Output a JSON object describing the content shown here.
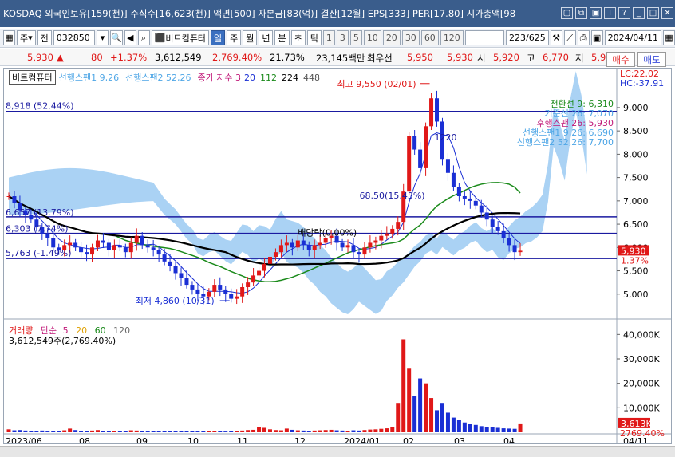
{
  "window": {
    "title": "KOSDAQ 외국인보유[159(천)] 주식수[16,623(천)] 액면[500] 자본금[83(억)] 결산[12월] EPS[333] PER[17.80] 시가총액[98",
    "buttons": [
      "▢",
      "⧉",
      "▣",
      "T",
      "?",
      "_",
      "□",
      "✕"
    ]
  },
  "toolbar": {
    "market_select": "주",
    "prev_label": "전",
    "code_input": "032850",
    "stock_name": "비트컴퓨터",
    "period_tabs": [
      "일",
      "주",
      "월",
      "년",
      "분",
      "초",
      "틱"
    ],
    "active_period": "일",
    "intervals": [
      "1",
      "3",
      "5",
      "10",
      "20",
      "30",
      "60",
      "120"
    ],
    "page_count": "223/625",
    "date_input": "2024/04/11"
  },
  "quote": {
    "price": "5,930",
    "change": "80",
    "change_pct": "+1.37%",
    "volume": "3,612,549",
    "volume_ratio": "2,769.40%",
    "turnover": "21.73%",
    "trade_value": "23,145백만",
    "best_ask_label": "최우선",
    "best_ask": "5,950",
    "best_bid": "5,930",
    "open_label": "시",
    "open": "5,920",
    "high_label": "고",
    "high": "6,770",
    "low_label": "저",
    "low": "5,920",
    "buy_label": "매수",
    "sell_label": "매도"
  },
  "chart_legend": {
    "name": "비트컴퓨터",
    "span1": "선행스팬1 9,26",
    "span2": "선행스팬2 52,26",
    "ma_label": "종가 지수 3",
    "ma_periods": [
      "20",
      "112",
      "224",
      "448"
    ],
    "lc": "LC:22.02",
    "hc": "HC:-37.91"
  },
  "annotations": {
    "high": "최고 9,550 (02/01)",
    "low": "최저 4,860 (10/31)",
    "line_8918": "8,918 (52.44%)",
    "line_6657": "6,657 (13.79%)",
    "line_6303": "6,303 (7.74%)",
    "line_5763": "5,763 (-1.49%)",
    "pct_6850": "68.50(15.43%)",
    "val_1220": "1220",
    "base": "배당락(0.00%)",
    "ichimoku": [
      "전환선 9: 6,310",
      "기준선 26: 7,070",
      "후행스팬 26: 5,930",
      "선행스팬1 9,26: 6,690",
      "선행스팬2 52,26: 7,700"
    ],
    "price_tag": "5,930",
    "pct_tag": "1.37%"
  },
  "volume_legend": {
    "label": "거래량",
    "simple": "단순",
    "periods": [
      "5",
      "20",
      "60",
      "120"
    ],
    "info": "3,612,549주(2,769.40%)",
    "tag": "3,613K",
    "pct_tag": "2769.40%"
  },
  "chart_data": {
    "type": "candlestick",
    "price_axis": {
      "range": [
        4500,
        9700
      ],
      "ticks": [
        5000,
        5500,
        6000,
        6500,
        7000,
        7500,
        8000,
        8500,
        9000
      ],
      "tick_labels": [
        "5,000",
        "5,500",
        "6,000",
        "6,500",
        "7,000",
        "7,500",
        "8,000",
        "8,500",
        "9,000"
      ]
    },
    "volume_axis": {
      "range": [
        0,
        45000
      ],
      "ticks": [
        10000,
        20000,
        30000,
        40000
      ],
      "tick_labels": [
        "10,000K",
        "20,000K",
        "30,000K",
        "40,000K"
      ]
    },
    "x_labels": [
      "2023/06",
      "08",
      "09",
      "10",
      "11",
      "12",
      "2024/01",
      "02",
      "03",
      "04",
      "04/11"
    ],
    "horizontal_lines": [
      8918,
      6657,
      6303,
      5763
    ],
    "high": {
      "date": "02/01",
      "value": 9550
    },
    "low": {
      "date": "10/31",
      "value": 4860
    },
    "last": {
      "close": 5930,
      "open": 5920,
      "high": 6770,
      "low": 5920
    },
    "close_series": [
      7100,
      6950,
      6800,
      6700,
      6600,
      6450,
      6300,
      6200,
      6000,
      5950,
      6050,
      6100,
      6000,
      5900,
      5850,
      6000,
      6150,
      6100,
      5950,
      6050,
      6000,
      5900,
      6100,
      6250,
      6050,
      6000,
      5950,
      5850,
      5700,
      5600,
      5450,
      5350,
      5200,
      5100,
      5000,
      4950,
      5050,
      5200,
      5100,
      5000,
      4900,
      4950,
      5150,
      5250,
      5400,
      5500,
      5650,
      5800,
      5900,
      6050,
      6100,
      6000,
      6150,
      6050,
      5950,
      6050,
      6100,
      6200,
      6250,
      6100,
      6000,
      6050,
      5900,
      5850,
      6000,
      6100,
      6150,
      6250,
      6300,
      6400,
      6550,
      7200,
      8400,
      8100,
      7700,
      8600,
      9200,
      8700,
      7900,
      7600,
      7300,
      7100,
      7050,
      7000,
      6900,
      6750,
      6600,
      6450,
      6350,
      6200,
      6050,
      5900,
      5930
    ],
    "volume_series": [
      1200,
      800,
      900,
      700,
      600,
      500,
      700,
      600,
      500,
      400,
      800,
      1500,
      900,
      600,
      500,
      700,
      900,
      600,
      500,
      400,
      500,
      600,
      800,
      700,
      500,
      400,
      500,
      600,
      500,
      400,
      400,
      500,
      600,
      500,
      400,
      500,
      600,
      500,
      400,
      300,
      500,
      600,
      700,
      900,
      1000,
      2000,
      1800,
      1200,
      900,
      800,
      1500,
      1000,
      800,
      700,
      600,
      700,
      800,
      900,
      1000,
      800,
      700,
      600,
      800,
      700,
      900,
      1100,
      1200,
      1400,
      1600,
      2000,
      12000,
      38000,
      26000,
      15000,
      22000,
      20000,
      14000,
      9000,
      12000,
      8000,
      6000,
      5000,
      4000,
      3500,
      3000,
      2500,
      2200,
      2000,
      1800,
      1600,
      1500,
      1400,
      3613
    ]
  },
  "colors": {
    "up": "#e01818",
    "down": "#1a2fd4",
    "cloud": "#8ec3f0",
    "accent": "#3a5d8c"
  }
}
